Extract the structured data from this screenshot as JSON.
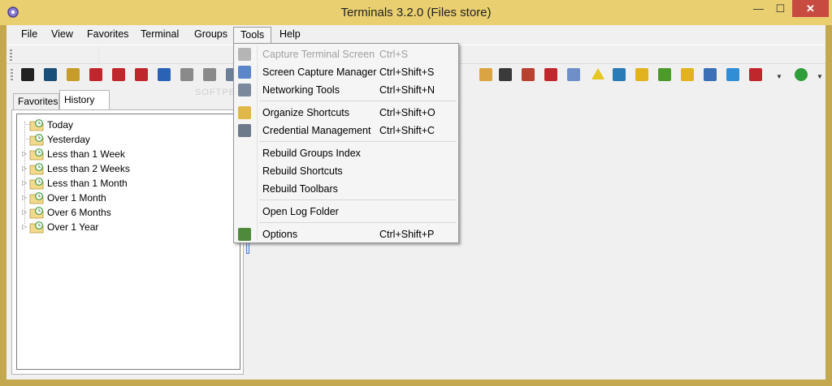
{
  "window": {
    "title": "Terminals 3.2.0 (Files store)",
    "controls": {
      "minimize": "—",
      "maximize": "☐",
      "close": "✕"
    },
    "title_bar_color": "#e9cf70",
    "frame_color": "#c4a84f",
    "close_button_color": "#c74b41"
  },
  "menubar": {
    "items": [
      {
        "label": "File"
      },
      {
        "label": "View"
      },
      {
        "label": "Favorites"
      },
      {
        "label": "Terminal"
      },
      {
        "label": "Groups"
      },
      {
        "label": "Tools",
        "open": true
      },
      {
        "label": "Help"
      }
    ]
  },
  "watermark": "SOFTPEDIA",
  "toolbar": {
    "icons": [
      {
        "name": "console-icon",
        "color": "#222222"
      },
      {
        "name": "terminal-icon",
        "color": "#1a4f7a"
      },
      {
        "name": "tools-icon",
        "color": "#c69c2a"
      },
      {
        "name": "rdp-connection-icon",
        "color": "#c0272d"
      },
      {
        "name": "rdp-connection-icon",
        "color": "#c0272d"
      },
      {
        "name": "rdp-connection-icon",
        "color": "#c0272d"
      },
      {
        "name": "network-computer-icon",
        "color": "#2a62b5"
      },
      {
        "name": "server-icon",
        "color": "#8a8a8a"
      },
      {
        "name": "server-icon",
        "color": "#8a8a8a"
      },
      {
        "name": "capture-icon",
        "color": "#6b7f99"
      },
      {
        "name": "rdp-connection-icon",
        "color": "#c0272d"
      },
      {
        "name": "notes-icon",
        "color": "#d9a441"
      },
      {
        "name": "film-icon",
        "color": "#3a3a3a"
      },
      {
        "name": "network-icon",
        "color": "#b8412f"
      },
      {
        "name": "rdp-connection-icon",
        "color": "#c0272d"
      },
      {
        "name": "computers-icon",
        "color": "#6f8fc8"
      },
      {
        "name": "warning-icon",
        "color": "#e6c622"
      },
      {
        "name": "monitor-icon",
        "color": "#2a7ab5"
      },
      {
        "name": "keys-icon",
        "color": "#e2b21f"
      },
      {
        "name": "add-server-icon",
        "color": "#4c9a2a"
      },
      {
        "name": "keys-icon",
        "color": "#e2b21f"
      },
      {
        "name": "home-icon",
        "color": "#3b6fb6"
      },
      {
        "name": "globe-icon",
        "color": "#2f8ed6"
      },
      {
        "name": "wireless-icon",
        "color": "#c0272d"
      },
      {
        "name": "add-icon",
        "color": "#2f9e3a"
      }
    ]
  },
  "tabs": [
    {
      "label": "Favorites",
      "active": false
    },
    {
      "label": "History",
      "active": true
    }
  ],
  "history": {
    "nodes": [
      {
        "label": "Today",
        "expandable": false
      },
      {
        "label": "Yesterday",
        "expandable": false
      },
      {
        "label": "Less than 1 Week",
        "expandable": true
      },
      {
        "label": "Less than 2 Weeks",
        "expandable": true
      },
      {
        "label": "Less than 1 Month",
        "expandable": true
      },
      {
        "label": "Over 1 Month",
        "expandable": true
      },
      {
        "label": "Over 6 Months",
        "expandable": true
      },
      {
        "label": "Over 1 Year",
        "expandable": true
      }
    ]
  },
  "tools_menu": {
    "items": [
      {
        "label": "Capture Terminal Screen",
        "shortcut": "Ctrl+S",
        "disabled": true,
        "icon": "camera-icon"
      },
      {
        "label": "Screen Capture Manager",
        "shortcut": "Ctrl+Shift+S",
        "icon": "capture-manager-icon"
      },
      {
        "label": "Networking Tools",
        "shortcut": "Ctrl+Shift+N",
        "icon": "networking-tools-icon"
      },
      {
        "separator": true
      },
      {
        "label": "Organize Shortcuts",
        "shortcut": "Ctrl+Shift+O",
        "icon": "organize-shortcuts-icon"
      },
      {
        "label": "Credential Management",
        "shortcut": "Ctrl+Shift+C",
        "icon": "credential-icon"
      },
      {
        "separator": true
      },
      {
        "label": "Rebuild Groups Index"
      },
      {
        "label": "Rebuild Shortcuts"
      },
      {
        "label": "Rebuild Toolbars"
      },
      {
        "separator": true
      },
      {
        "label": "Open Log Folder"
      },
      {
        "separator": true
      },
      {
        "label": "Options",
        "shortcut": "Ctrl+Shift+P",
        "icon": "options-icon"
      }
    ]
  }
}
